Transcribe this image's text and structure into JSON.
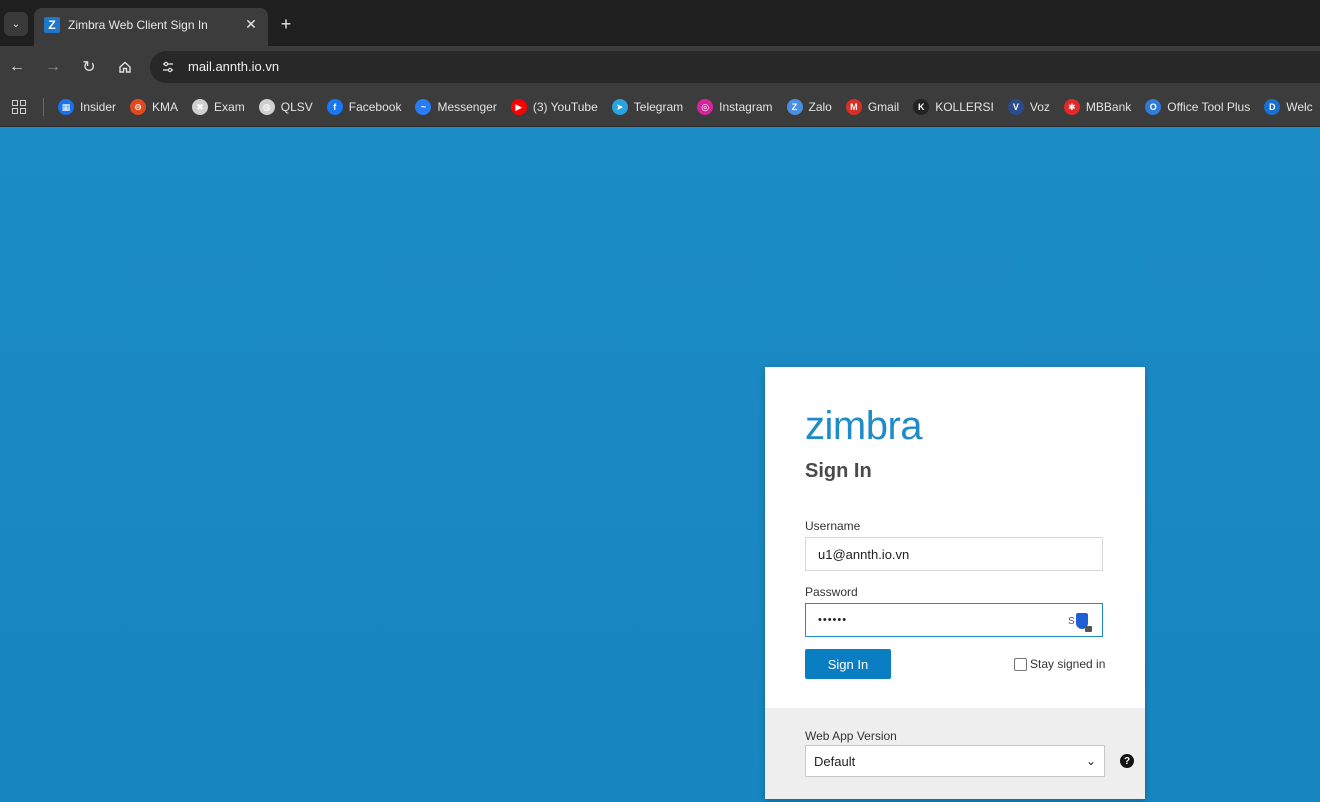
{
  "browser": {
    "tab": {
      "title": "Zimbra Web Client Sign In",
      "favicon_letter": "Z",
      "close_glyph": "✕"
    },
    "new_tab_glyph": "+",
    "url": "mail.annth.io.vn",
    "bookmarks": [
      {
        "label": "Insider",
        "icon": "windows-icon",
        "color": "#1a73e8",
        "glyph": "▦"
      },
      {
        "label": "KMA",
        "icon": "kma-icon",
        "color": "#e04a1f",
        "glyph": "⊖"
      },
      {
        "label": "Exam",
        "icon": "exam-icon",
        "color": "#cfcfcf",
        "glyph": "✖"
      },
      {
        "label": "QLSV",
        "icon": "globe-icon",
        "color": "#cfcfcf",
        "glyph": "◍"
      },
      {
        "label": "Facebook",
        "icon": "facebook-icon",
        "color": "#1877f2",
        "glyph": "f"
      },
      {
        "label": "Messenger",
        "icon": "messenger-icon",
        "color": "#2a7cf6",
        "glyph": "~"
      },
      {
        "label": "(3) YouTube",
        "icon": "youtube-icon",
        "color": "#ff0000",
        "glyph": "▶"
      },
      {
        "label": "Telegram",
        "icon": "telegram-icon",
        "color": "#2aa3df",
        "glyph": "➤"
      },
      {
        "label": "Instagram",
        "icon": "instagram-icon",
        "color": "#d6249f",
        "glyph": "◎"
      },
      {
        "label": "Zalo",
        "icon": "zalo-icon",
        "color": "#4a90e2",
        "glyph": "Z"
      },
      {
        "label": "Gmail",
        "icon": "gmail-icon",
        "color": "#d93025",
        "glyph": "M"
      },
      {
        "label": "KOLLERSI",
        "icon": "kollersi-icon",
        "color": "#222222",
        "glyph": "K"
      },
      {
        "label": "Voz",
        "icon": "voz-icon",
        "color": "#2b4c8c",
        "glyph": "V"
      },
      {
        "label": "MBBank",
        "icon": "mbbank-icon",
        "color": "#e32a2a",
        "glyph": "✱"
      },
      {
        "label": "Office Tool Plus",
        "icon": "office-tool-plus-icon",
        "color": "#2f7bd6",
        "glyph": "O"
      },
      {
        "label": "Welc",
        "icon": "dsm-icon",
        "color": "#1a6fd0",
        "glyph": "D"
      }
    ]
  },
  "login": {
    "logo": "zimbra",
    "title": "Sign In",
    "username_label": "Username",
    "username_value": "u1@annth.io.vn",
    "password_label": "Password",
    "password_value": "••••••",
    "password_ext_letter": "S",
    "signin_label": "Sign In",
    "stay_signed_in_label": "Stay signed in",
    "stay_signed_in_checked": false,
    "webapp_version_label": "Web App Version",
    "webapp_version_value": "Default",
    "help_glyph": "?"
  },
  "colors": {
    "page_background": "#1a8ac4",
    "accent": "#0a7ec2",
    "logo": "#1f8bc7"
  }
}
